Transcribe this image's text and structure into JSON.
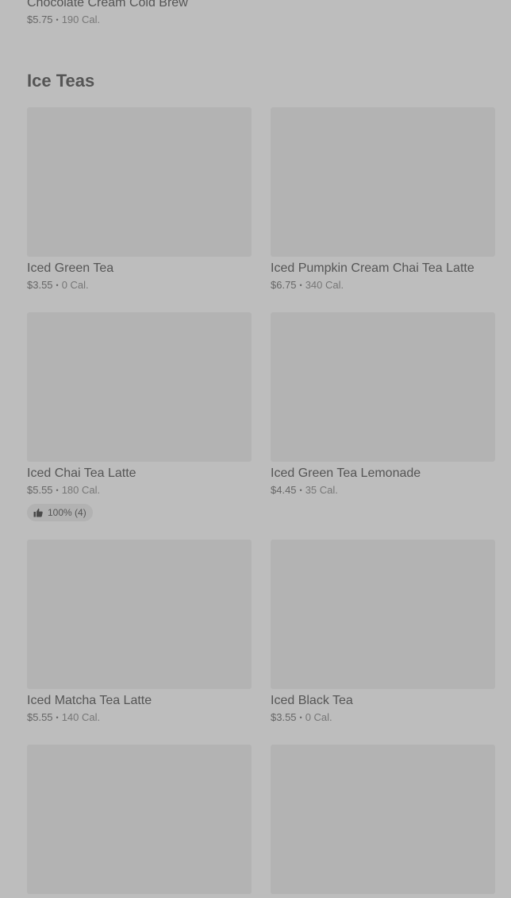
{
  "previous_item": {
    "name": "Chocolate Cream Cold Brew",
    "price": "$5.75",
    "calories": "190 Cal."
  },
  "section": {
    "title": "Ice Teas"
  },
  "items": [
    {
      "name": "Iced Green Tea",
      "price": "$3.55",
      "calories": "0 Cal."
    },
    {
      "name": "Iced Pumpkin Cream Chai Tea Latte",
      "price": "$6.75",
      "calories": "340 Cal."
    },
    {
      "name": "Iced Chai Tea Latte",
      "price": "$5.55",
      "calories": "180 Cal.",
      "rating": "100% (4)"
    },
    {
      "name": "Iced Green Tea Lemonade",
      "price": "$4.45",
      "calories": "35 Cal."
    },
    {
      "name": "Iced Matcha Tea Latte",
      "price": "$5.55",
      "calories": "140 Cal."
    },
    {
      "name": "Iced Black Tea",
      "price": "$3.55",
      "calories": "0 Cal."
    }
  ],
  "separator": "•",
  "icons": {
    "rating": "thumbs-up-icon"
  },
  "colors": {
    "background": "#bdbdbd",
    "image_placeholder": "#b3b3b3",
    "text": "#555555"
  }
}
